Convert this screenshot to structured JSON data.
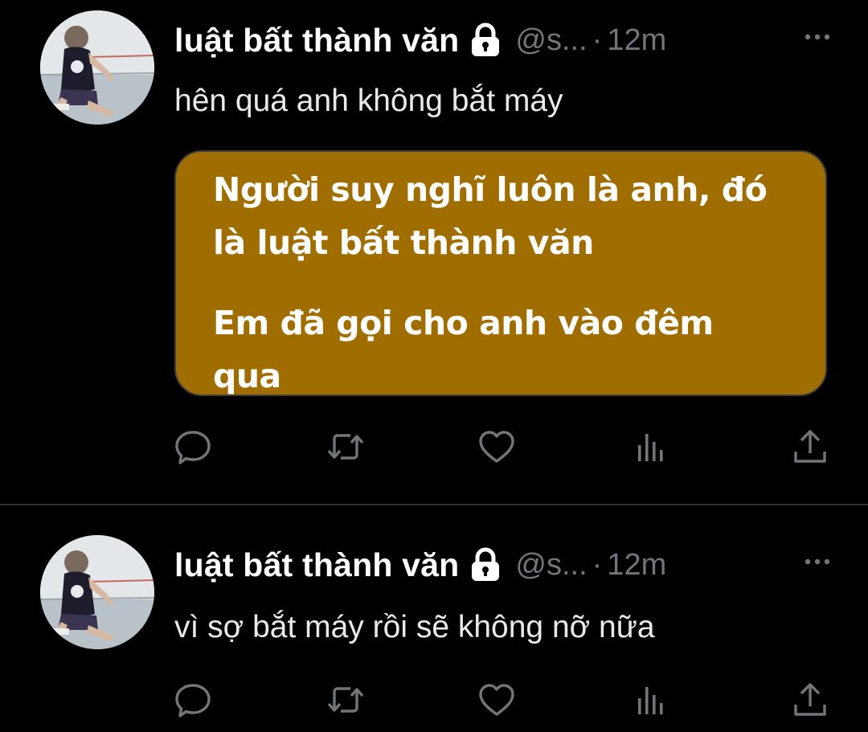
{
  "colors": {
    "background": "#000000",
    "primary_text": "#e7e9ea",
    "secondary_text": "#71767b",
    "divider": "#2f3336",
    "card_background": "#a06e00",
    "card_text": "#ffffff"
  },
  "tweets": [
    {
      "author": {
        "display_name": "luật bất thành văn",
        "handle": "@s...",
        "protected_icon": "lock-icon"
      },
      "separator": "·",
      "time": "12m",
      "text": "hên quá anh không bắt máy",
      "media_card": {
        "paragraphs": [
          {
            "lines": [
              "Người suy nghĩ luôn là anh, đó",
              "là luật bất thành văn"
            ]
          },
          {
            "lines": [
              "Em đã gọi cho anh vào đêm",
              "qua"
            ]
          }
        ]
      },
      "actions": [
        "reply-icon",
        "retweet-icon",
        "like-icon",
        "views-icon",
        "share-icon"
      ]
    },
    {
      "author": {
        "display_name": "luật bất thành văn",
        "handle": "@s...",
        "protected_icon": "lock-icon"
      },
      "separator": "·",
      "time": "12m",
      "text": "vì sợ bắt máy rồi sẽ không nỡ nữa",
      "actions": [
        "reply-icon",
        "retweet-icon",
        "like-icon",
        "views-icon",
        "share-icon"
      ]
    }
  ]
}
